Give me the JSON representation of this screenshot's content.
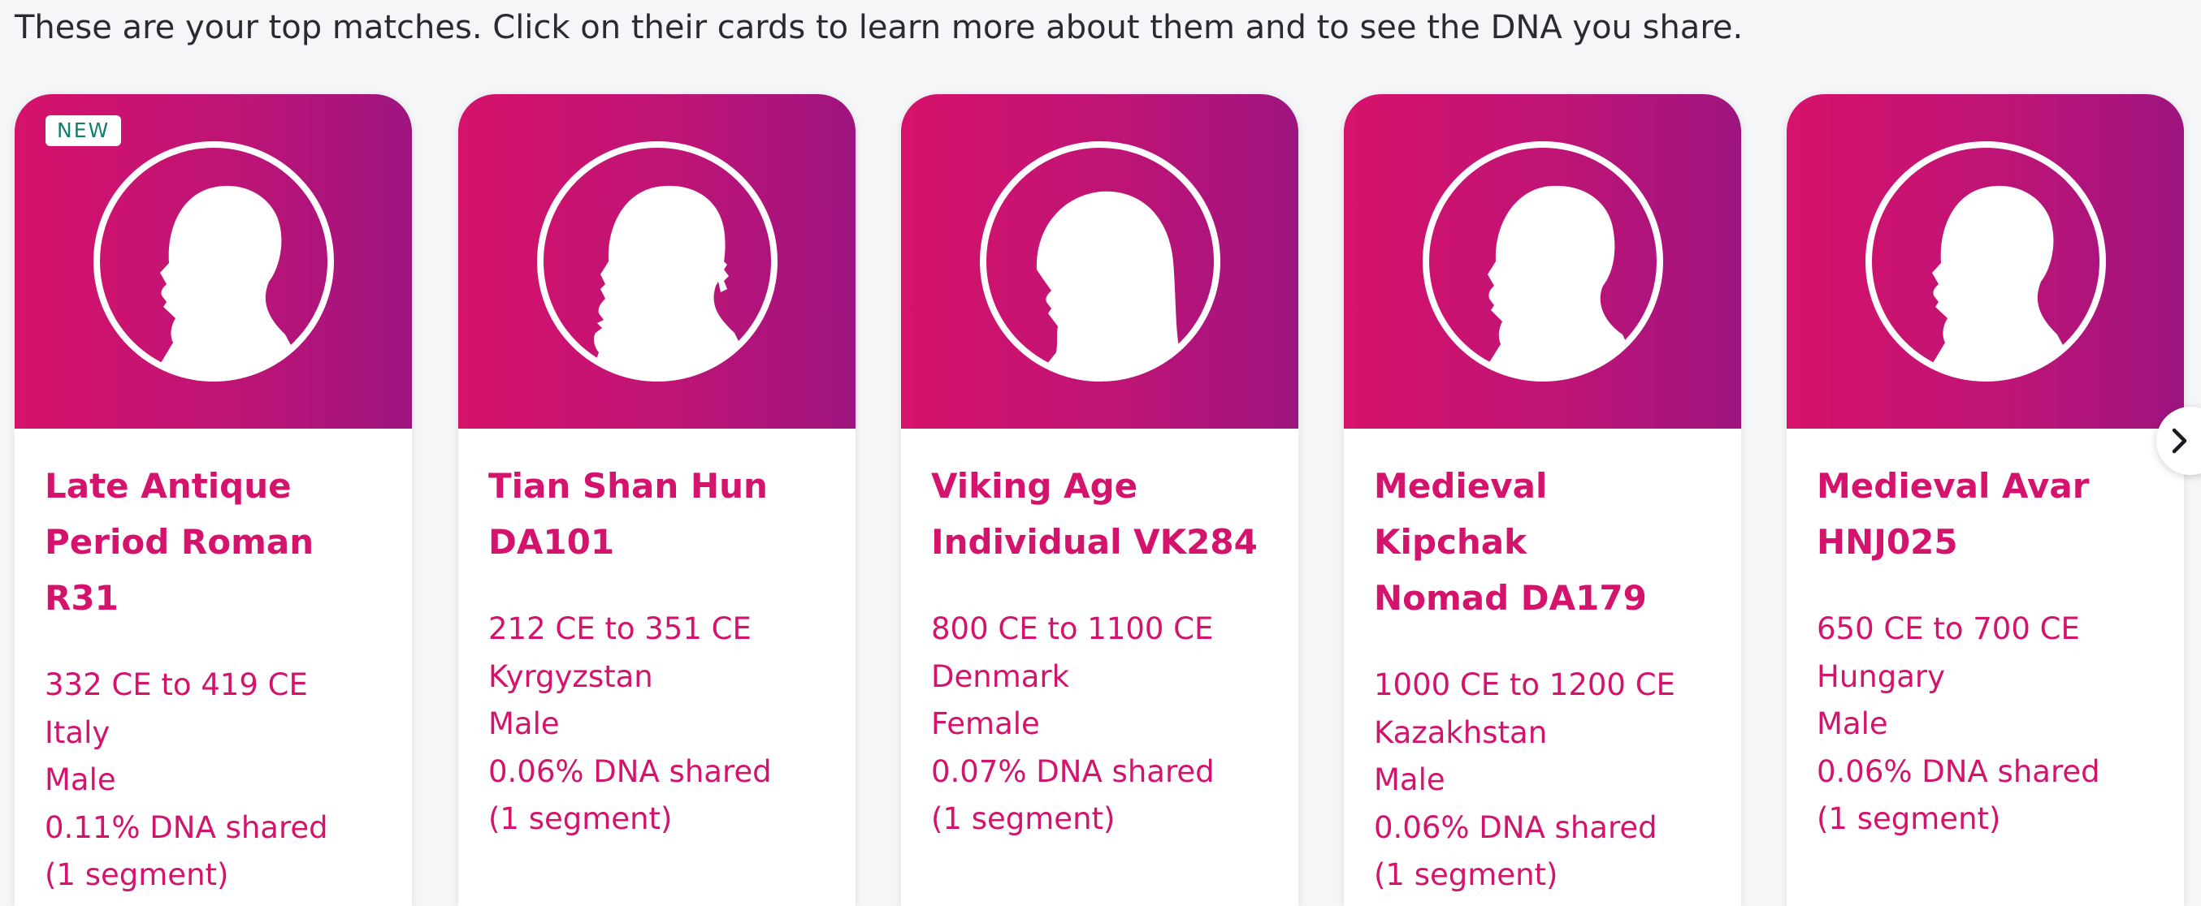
{
  "intro_text": "These are your top matches. Click on their cards to learn more about them and to see the DNA you share.",
  "colors": {
    "accent": "#d4146c",
    "gradient_start": "#d6126b",
    "gradient_end": "#9e1580",
    "badge_text": "#127e6e"
  },
  "cards": [
    {
      "badge": "NEW",
      "title_line1": "Late Antique",
      "title_line2": "Period Roman R31",
      "date_range": "332 CE to 419 CE",
      "location": "Italy",
      "sex": "Male",
      "dna_shared": "0.11% DNA shared",
      "segments": "(1 segment)",
      "portrait_icon": "male-silhouette-icon"
    },
    {
      "title_line1": "Tian Shan Hun",
      "title_line2": "DA101",
      "date_range": "212 CE to 351 CE",
      "location": "Kyrgyzstan",
      "sex": "Male",
      "dna_shared": "0.06% DNA shared",
      "segments": "(1 segment)",
      "portrait_icon": "bearded-male-silhouette-icon"
    },
    {
      "title_line1": "Viking Age",
      "title_line2": "Individual VK284",
      "date_range": "800 CE to 1100 CE",
      "location": "Denmark",
      "sex": "Female",
      "dna_shared": "0.07% DNA shared",
      "segments": "(1 segment)",
      "portrait_icon": "female-silhouette-icon"
    },
    {
      "title_line1": "Medieval Kipchak",
      "title_line2": "Nomad DA179",
      "date_range": "1000 CE to 1200 CE",
      "location": "Kazakhstan",
      "sex": "Male",
      "dna_shared": "0.06% DNA shared",
      "segments": "(1 segment)",
      "portrait_icon": "male-silhouette-icon"
    },
    {
      "title_line1": "Medieval Avar",
      "title_line2": "HNJ025",
      "date_range": "650 CE to 700 CE",
      "location": "Hungary",
      "sex": "Male",
      "dna_shared": "0.06% DNA shared",
      "segments": "(1 segment)",
      "portrait_icon": "male-silhouette-icon"
    }
  ],
  "carousel": {
    "next_icon": "chevron-right-icon"
  }
}
